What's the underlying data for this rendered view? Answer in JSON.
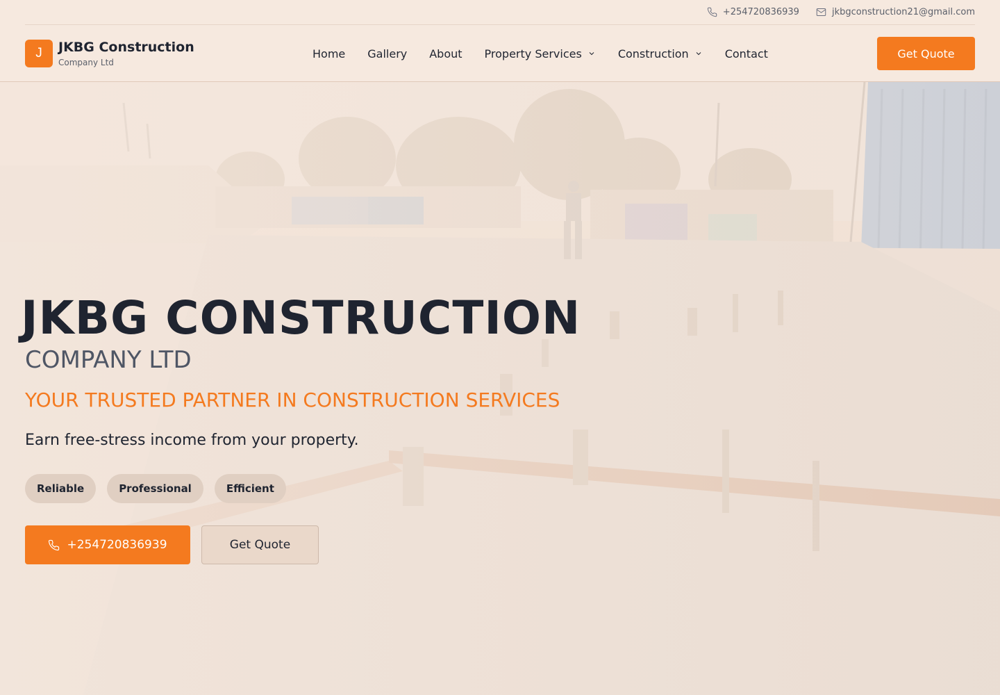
{
  "colors": {
    "accent": "#f47a1f",
    "text": "#1f2430",
    "muted": "#4f5665",
    "background": "#f6e9df"
  },
  "topbar": {
    "phone": "+254720836939",
    "phone_icon": "phone-icon",
    "email": "jkbgconstruction21@gmail.com",
    "email_icon": "mail-icon"
  },
  "brand": {
    "mark": "J",
    "name": "JKBG Construction",
    "subtitle": "Company Ltd"
  },
  "nav": {
    "items": [
      {
        "label": "Home"
      },
      {
        "label": "Gallery"
      },
      {
        "label": "About"
      },
      {
        "label": "Property Services",
        "icon": "chevron-down-icon"
      },
      {
        "label": "Construction",
        "icon": "chevron-down-icon"
      },
      {
        "label": "Contact"
      }
    ],
    "quote_button": "Get Quote"
  },
  "hero": {
    "title": "JKBG CONSTRUCTION",
    "subtitle": "COMPANY LTD",
    "tagline": "YOUR TRUSTED PARTNER IN CONSTRUCTION SERVICES",
    "description": "Earn free-stress income from your property.",
    "chips": [
      "Reliable",
      "Professional",
      "Efficient"
    ],
    "phone_button": "+254720836939",
    "quote_button": "Get Quote"
  }
}
